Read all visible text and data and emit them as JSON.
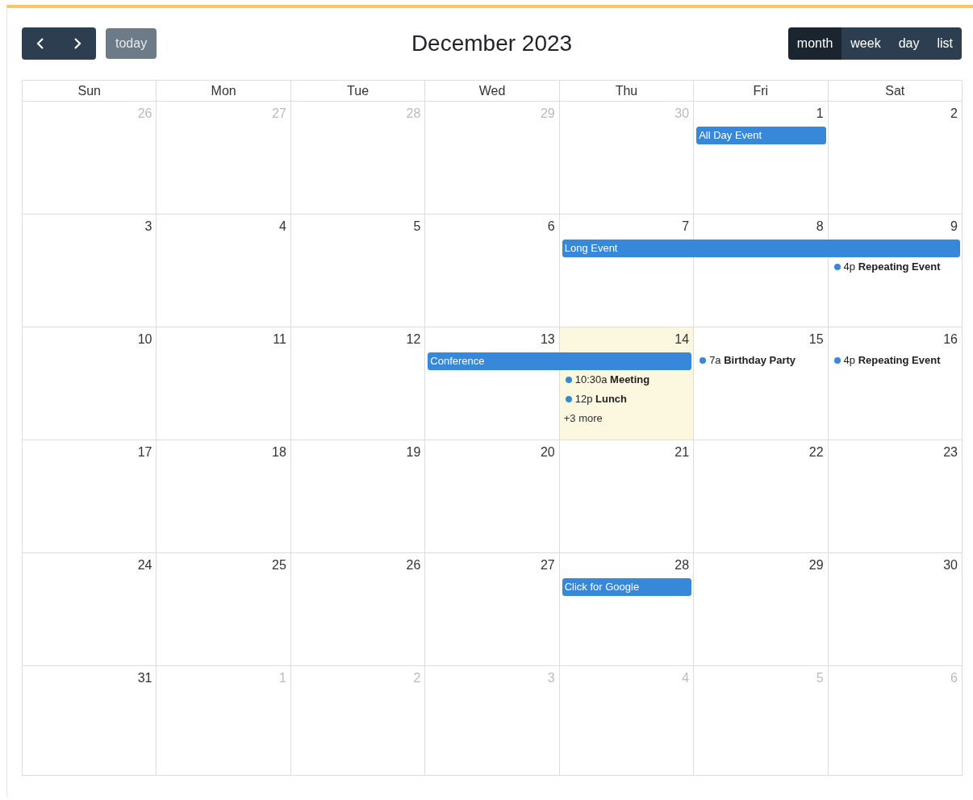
{
  "toolbar": {
    "title": "December 2023",
    "today": {
      "label": "today",
      "disabled": true
    },
    "views": [
      {
        "label": "month",
        "selected": true
      },
      {
        "label": "week",
        "selected": false
      },
      {
        "label": "day",
        "selected": false
      },
      {
        "label": "list",
        "selected": false
      }
    ]
  },
  "weekdays": [
    "Sun",
    "Mon",
    "Tue",
    "Wed",
    "Thu",
    "Fri",
    "Sat"
  ],
  "weeks": [
    {
      "days": [
        {
          "day": "26",
          "other_month": true,
          "today": false
        },
        {
          "day": "27",
          "other_month": true,
          "today": false
        },
        {
          "day": "28",
          "other_month": true,
          "today": false
        },
        {
          "day": "29",
          "other_month": true,
          "today": false
        },
        {
          "day": "30",
          "other_month": true,
          "today": false
        },
        {
          "day": "1",
          "other_month": false,
          "today": false,
          "events": [
            {
              "kind": "bar",
              "title": "All Day Event"
            }
          ]
        },
        {
          "day": "2",
          "other_month": false,
          "today": false
        }
      ]
    },
    {
      "days": [
        {
          "day": "3",
          "other_month": false,
          "today": false
        },
        {
          "day": "4",
          "other_month": false,
          "today": false
        },
        {
          "day": "5",
          "other_month": false,
          "today": false
        },
        {
          "day": "6",
          "other_month": false,
          "today": false
        },
        {
          "day": "7",
          "other_month": false,
          "today": false,
          "events": [
            {
              "kind": "bar",
              "title": "Long Event"
            }
          ]
        },
        {
          "day": "8",
          "other_month": false,
          "today": false,
          "events": [
            {
              "kind": "continued"
            }
          ]
        },
        {
          "day": "9",
          "other_month": false,
          "today": false,
          "events": [
            {
              "kind": "continued"
            },
            {
              "kind": "dot",
              "time": "4p",
              "title": "Repeating Event"
            }
          ]
        }
      ]
    },
    {
      "days": [
        {
          "day": "10",
          "other_month": false,
          "today": false
        },
        {
          "day": "11",
          "other_month": false,
          "today": false
        },
        {
          "day": "12",
          "other_month": false,
          "today": false
        },
        {
          "day": "13",
          "other_month": false,
          "today": false,
          "events": [
            {
              "kind": "bar",
              "title": "Conference"
            }
          ]
        },
        {
          "day": "14",
          "other_month": false,
          "today": true,
          "events": [
            {
              "kind": "continued"
            },
            {
              "kind": "dot",
              "time": "10:30a",
              "title": "Meeting"
            },
            {
              "kind": "dot",
              "time": "12p",
              "title": "Lunch"
            },
            {
              "kind": "more",
              "label": "+3 more"
            }
          ]
        },
        {
          "day": "15",
          "other_month": false,
          "today": false,
          "events": [
            {
              "kind": "dot",
              "time": "7a",
              "title": "Birthday Party"
            }
          ]
        },
        {
          "day": "16",
          "other_month": false,
          "today": false,
          "events": [
            {
              "kind": "dot",
              "time": "4p",
              "title": "Repeating Event"
            }
          ]
        }
      ]
    },
    {
      "days": [
        {
          "day": "17",
          "other_month": false,
          "today": false
        },
        {
          "day": "18",
          "other_month": false,
          "today": false
        },
        {
          "day": "19",
          "other_month": false,
          "today": false
        },
        {
          "day": "20",
          "other_month": false,
          "today": false
        },
        {
          "day": "21",
          "other_month": false,
          "today": false
        },
        {
          "day": "22",
          "other_month": false,
          "today": false
        },
        {
          "day": "23",
          "other_month": false,
          "today": false
        }
      ]
    },
    {
      "days": [
        {
          "day": "24",
          "other_month": false,
          "today": false
        },
        {
          "day": "25",
          "other_month": false,
          "today": false
        },
        {
          "day": "26",
          "other_month": false,
          "today": false
        },
        {
          "day": "27",
          "other_month": false,
          "today": false
        },
        {
          "day": "28",
          "other_month": false,
          "today": false,
          "events": [
            {
              "kind": "bar",
              "title": "Click for Google"
            }
          ]
        },
        {
          "day": "29",
          "other_month": false,
          "today": false
        },
        {
          "day": "30",
          "other_month": false,
          "today": false
        }
      ]
    },
    {
      "days": [
        {
          "day": "31",
          "other_month": false,
          "today": false
        },
        {
          "day": "1",
          "other_month": true,
          "today": false
        },
        {
          "day": "2",
          "other_month": true,
          "today": false
        },
        {
          "day": "3",
          "other_month": true,
          "today": false
        },
        {
          "day": "4",
          "other_month": true,
          "today": false
        },
        {
          "day": "5",
          "other_month": true,
          "today": false
        },
        {
          "day": "6",
          "other_month": true,
          "today": false
        }
      ]
    }
  ]
}
